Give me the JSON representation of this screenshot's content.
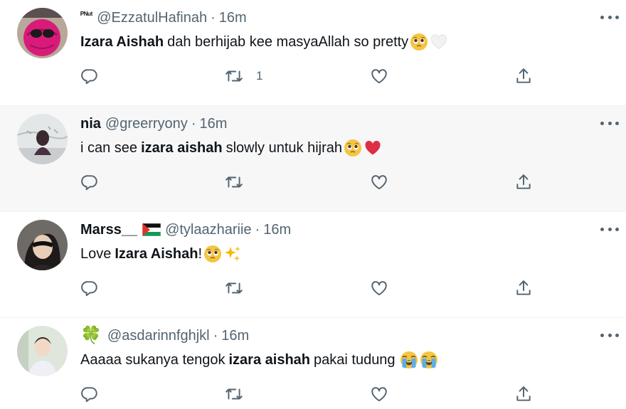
{
  "tweets": [
    {
      "name": "ᴾᴺᵘᵗ",
      "handle": "@EzzatulHafinah",
      "dot": "·",
      "time": "16m",
      "text_pre": "",
      "text_bold": "Izara Aishah",
      "text_post": "dah berhijab kee masyaAllah so pretty",
      "emojis": [
        "pleading-face-emoji",
        "white-heart-emoji"
      ],
      "retweet_count": "1"
    },
    {
      "name": "nia",
      "handle": "@greerryony",
      "dot": "·",
      "time": "16m",
      "text_pre": "i can see",
      "text_bold": "izara aishah",
      "text_post": "slowly untuk hijrah",
      "emojis": [
        "pleading-face-emoji",
        "red-heart-emoji"
      ],
      "retweet_count": ""
    },
    {
      "name": "Marss__",
      "flag": "palestine-flag-emoji",
      "handle": "@tylaazhariie",
      "dot": "·",
      "time": "16m",
      "text_pre": "Love",
      "text_bold": "Izara Aishah",
      "text_post": "!",
      "emojis": [
        "pleading-face-emoji",
        "sparkles-emoji"
      ],
      "retweet_count": ""
    },
    {
      "name": "🍀",
      "handle": "@asdarinnfghjkl",
      "dot": "·",
      "time": "16m",
      "text_pre": "Aaaaa sukanya tengok",
      "text_bold": "izara aishah",
      "text_post": "pakai tudung",
      "emojis": [
        "loudly-crying-face-emoji",
        "loudly-crying-face-emoji"
      ],
      "retweet_count": ""
    }
  ],
  "colors": {
    "text": "#0f1419",
    "secondary": "#536471",
    "highlight_bg": "#f7f7f7",
    "divider": "#eff3f4"
  },
  "icons": [
    "reply-icon",
    "retweet-icon",
    "like-icon",
    "share-icon",
    "more-icon"
  ]
}
